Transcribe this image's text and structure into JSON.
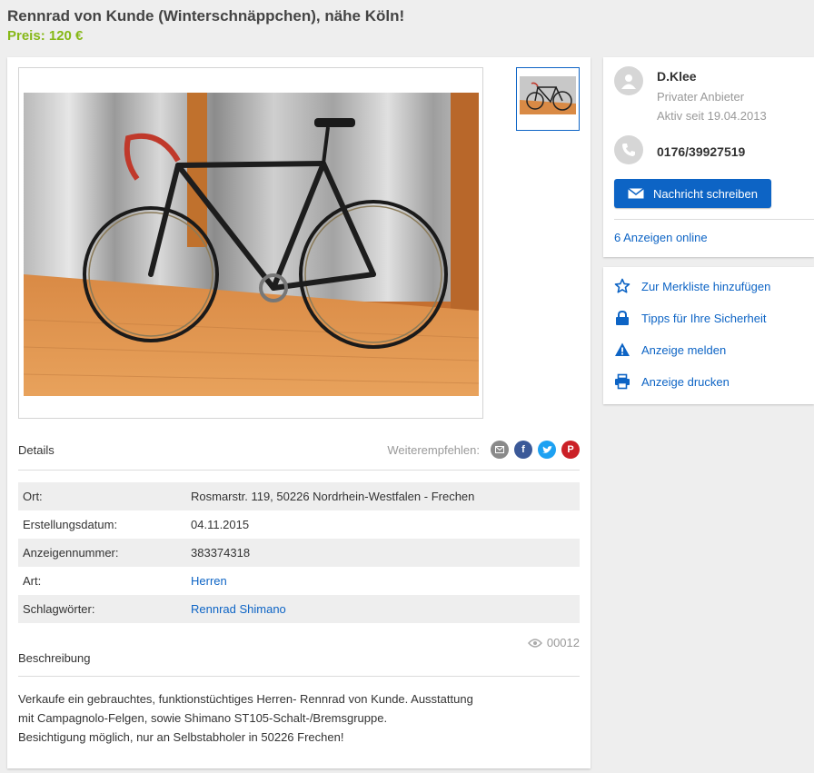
{
  "listing": {
    "title": "Rennrad von Kunde (Winterschnäppchen), nähe Köln!",
    "price": "Preis: 120 €"
  },
  "details": {
    "heading": "Details",
    "share_label": "Weiterempfehlen:",
    "share_icons": [
      "mail-icon",
      "facebook-icon",
      "twitter-icon",
      "pinterest-icon"
    ],
    "rows": [
      {
        "key": "Ort:",
        "value": "Rosmarstr. 119, 50226 Nordrhein-Westfalen - Frechen"
      },
      {
        "key": "Erstellungsdatum:",
        "value": "04.11.2015"
      },
      {
        "key": "Anzeigennummer:",
        "value": "383374318"
      },
      {
        "key": "Art:",
        "value": "Herren"
      },
      {
        "key": "Schlagwörter:",
        "value": "Rennrad Shimano"
      }
    ]
  },
  "views": "00012",
  "description": {
    "heading": "Beschreibung",
    "lines": [
      "Verkaufe ein gebrauchtes, funktionstüchtiges Herren- Rennrad von Kunde. Ausstattung",
      "mit Campagnolo-Felgen, sowie Shimano ST105-Schalt-/Bremsgruppe.",
      "Besichtigung möglich, nur an Selbstabholer in 50226 Frechen!"
    ]
  },
  "seller": {
    "name": "D.Klee",
    "type": "Privater Anbieter",
    "since": "Aktiv seit 19.04.2013",
    "phone": "0176/39927519",
    "message_button": "Nachricht schreiben",
    "ads_online": "6 Anzeigen online"
  },
  "actions": [
    {
      "label": "Zur Merkliste hinzufügen",
      "icon": "star-icon"
    },
    {
      "label": "Tipps für Ihre Sicherheit",
      "icon": "lock-icon"
    },
    {
      "label": "Anzeige melden",
      "icon": "warning-icon"
    },
    {
      "label": "Anzeige drucken",
      "icon": "printer-icon"
    }
  ],
  "colors": {
    "accent": "#0d64c5",
    "price": "#86b817",
    "facebook": "#3b5998",
    "twitter": "#1da1f2",
    "pinterest": "#cb2027",
    "mail": "#8a8a8a"
  }
}
